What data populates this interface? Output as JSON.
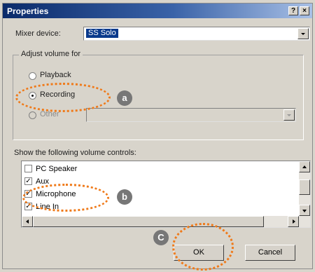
{
  "window": {
    "title": "Properties",
    "help_glyph": "?",
    "close_glyph": "×"
  },
  "mixer": {
    "label": "Mixer device:",
    "value": "SS Solo"
  },
  "adjust_group": {
    "legend": "Adjust volume for",
    "options": [
      {
        "label": "Playback",
        "selected": false,
        "enabled": true
      },
      {
        "label": "Recording",
        "selected": true,
        "enabled": true
      },
      {
        "label": "Other",
        "selected": false,
        "enabled": false
      }
    ],
    "other_value": ""
  },
  "controls": {
    "label": "Show the following volume controls:",
    "items": [
      {
        "label": "PC Speaker",
        "checked": false
      },
      {
        "label": "Aux",
        "checked": true
      },
      {
        "label": "Microphone",
        "checked": true
      },
      {
        "label": "Line In",
        "checked": true
      }
    ],
    "check_glyph": "✓"
  },
  "buttons": {
    "ok": "OK",
    "cancel": "Cancel"
  },
  "annotations": {
    "a": "a",
    "b": "b",
    "c": "C",
    "callout_color": "#ef7a1a",
    "badge_color": "#777777"
  }
}
